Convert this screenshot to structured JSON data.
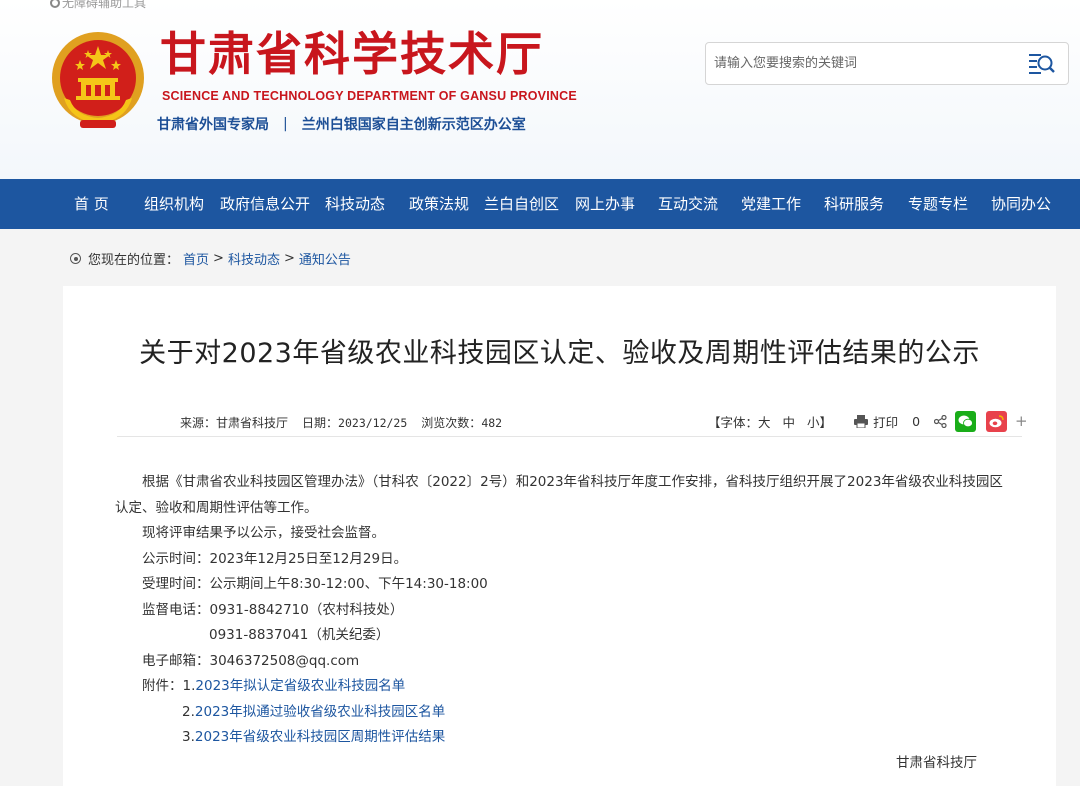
{
  "header": {
    "accessibility_label": "无障碍辅助工具",
    "title_cn": "甘肃省科学技术厅",
    "title_en": "SCIENCE AND TECHNOLOGY DEPARTMENT OF GANSU PROVINCE",
    "sub_left": "甘肃省外国专家局",
    "sub_sep": "|",
    "sub_right": "兰州白银国家自主创新示范区办公室",
    "search_placeholder": "请输入您要搜索的关键词"
  },
  "nav": {
    "items": [
      "首 页",
      "组织机构",
      "政府信息公开",
      "科技动态",
      "政策法规",
      "兰白自创区",
      "网上办事",
      "互动交流",
      "党建工作",
      "科研服务",
      "专题专栏",
      "协同办公"
    ]
  },
  "breadcrumb": {
    "prefix": "您现在的位置：",
    "links": [
      "首页",
      "科技动态",
      "通知公告"
    ],
    "sep": ">"
  },
  "article": {
    "title": "关于对2023年省级农业科技园区认定、验收及周期性评估结果的公示",
    "source_label": "来源：",
    "source": "甘肃省科技厅",
    "date_label": "日期：",
    "date": "2023/12/25",
    "views_label": "浏览次数：",
    "views": "482",
    "font_label": "【字体：",
    "font_large": "大",
    "font_medium": "中",
    "font_small": "小】",
    "print_label": "打印",
    "share_count": "0",
    "paragraph1": "根据《甘肃省农业科技园区管理办法》（甘科农〔2022〕2号）和2023年省科技厅年度工作安排，省科技厅组织开展了2023年省级农业科技园区认定、验收和周期性评估等工作。",
    "paragraph2": "现将评审结果予以公示，接受社会监督。",
    "period": "公示时间：2023年12月25日至12月29日。",
    "hours": "受理时间：公示期间上午8:30-12:00、下午14:30-18:00",
    "phone1": "监督电话：0931-8842710（农村科技处）",
    "phone2": "0931-8837041（机关纪委）",
    "email": "电子邮箱：3046372508@qq.com",
    "attachments_label": "附件：",
    "attachments": [
      {
        "num": "1.",
        "text": "2023年拟认定省级农业科技园名单"
      },
      {
        "num": "2.",
        "text": "2023年拟通过验收省级农业科技园区名单"
      },
      {
        "num": "3.",
        "text": "2023年省级农业科技园区周期性评估结果"
      }
    ],
    "signature": "甘肃省科技厅"
  },
  "colors": {
    "brand_red": "#c8161d",
    "nav_blue": "#1d56a0",
    "link_blue": "#1d56a0",
    "wechat_green": "#1aad19",
    "weibo_red": "#e8424c"
  }
}
